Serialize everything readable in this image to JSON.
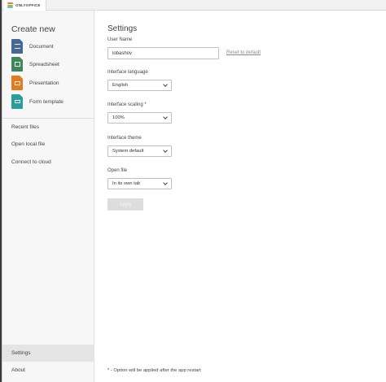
{
  "titlebar": {
    "app_name": "ONLYOFFICE"
  },
  "sidebar": {
    "create_title": "Create new",
    "create_items": [
      {
        "label": "Document",
        "icon": "document-icon",
        "color": "#446995"
      },
      {
        "label": "Spreadsheet",
        "icon": "spreadsheet-icon",
        "color": "#40865c"
      },
      {
        "label": "Presentation",
        "icon": "presentation-icon",
        "color": "#e37b1f"
      },
      {
        "label": "Form template",
        "icon": "form-template-icon",
        "color": "#2a9d9b"
      }
    ],
    "nav": {
      "recent": "Recent files",
      "open_local": "Open local file",
      "connect_cloud": "Connect to cloud",
      "settings": "Settings",
      "about": "About"
    }
  },
  "settings": {
    "title": "Settings",
    "username_label": "User Name",
    "username_value": "lobashov",
    "reset_link": "Reset to default",
    "language_label": "Interface language",
    "language_value": "English",
    "scaling_label": "Interface scaling *",
    "scaling_value": "100%",
    "theme_label": "Interface theme",
    "theme_value": "System default",
    "openfile_label": "Open file",
    "openfile_value": "In its own tab",
    "apply_label": "Apply",
    "footnote": "* - Option will be applied after the app restart"
  }
}
